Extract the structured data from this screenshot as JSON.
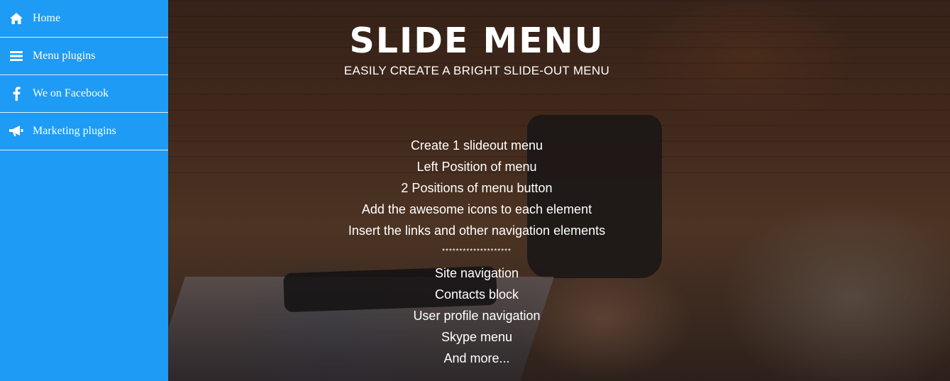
{
  "sidebar": {
    "items": [
      {
        "label": "Home",
        "icon": "home-icon"
      },
      {
        "label": "Menu plugins",
        "icon": "menu-icon"
      },
      {
        "label": "We on Facebook",
        "icon": "facebook-icon"
      },
      {
        "label": "Marketing plugins",
        "icon": "megaphone-icon"
      }
    ],
    "background": "#1e9bf4"
  },
  "hero": {
    "title": "SLIDE MENU",
    "subtitle": "EASILY CREATE A BRIGHT SLIDE-OUT MENU",
    "features": [
      "Create 1 slideout menu",
      "Left Position of menu",
      "2 Positions of menu button",
      "Add the awesome icons to each element",
      "Insert the links and other navigation elements",
      "********************",
      "Site navigation",
      "Contacts block",
      "User profile navigation",
      "Skype menu",
      "And more..."
    ]
  }
}
